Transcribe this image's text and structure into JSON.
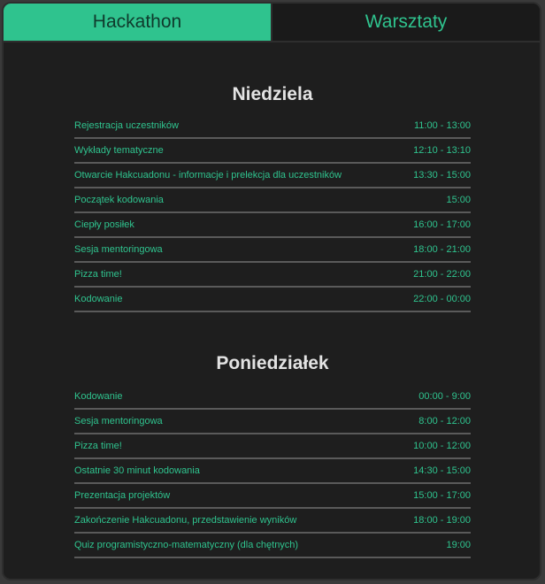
{
  "tabs": [
    {
      "label": "Hackathon",
      "active": true
    },
    {
      "label": "Warsztaty",
      "active": false
    }
  ],
  "colors": {
    "accent": "#2fc38e",
    "background": "#1e1e1e",
    "title": "#e3e3e3"
  },
  "sections": [
    {
      "title": "Niedziela",
      "events": [
        {
          "name": "Rejestracja uczestników",
          "time": "11:00 - 13:00"
        },
        {
          "name": "Wykłady tematyczne",
          "time": "12:10 - 13:10"
        },
        {
          "name": "Otwarcie Hakcuadonu - informacje i prelekcja dla uczestników",
          "time": "13:30 - 15:00"
        },
        {
          "name": "Początek kodowania",
          "time": "15:00"
        },
        {
          "name": "Ciepły posiłek",
          "time": "16:00 - 17:00"
        },
        {
          "name": "Sesja mentoringowa",
          "time": "18:00 - 21:00"
        },
        {
          "name": "Pizza time!",
          "time": "21:00 - 22:00"
        },
        {
          "name": "Kodowanie",
          "time": "22:00 - 00:00"
        }
      ]
    },
    {
      "title": "Poniedziałek",
      "events": [
        {
          "name": "Kodowanie",
          "time": "00:00 - 9:00"
        },
        {
          "name": "Sesja mentoringowa",
          "time": "8:00 - 12:00"
        },
        {
          "name": "Pizza time!",
          "time": "10:00 - 12:00"
        },
        {
          "name": "Ostatnie 30 minut kodowania",
          "time": "14:30 - 15:00"
        },
        {
          "name": "Prezentacja projektów",
          "time": "15:00 - 17:00"
        },
        {
          "name": "Zakończenie Hakcuadonu, przedstawienie wyników",
          "time": "18:00 - 19:00"
        },
        {
          "name": "Quiz programistyczno-matematyczny (dla chętnych)",
          "time": "19:00"
        }
      ]
    }
  ]
}
